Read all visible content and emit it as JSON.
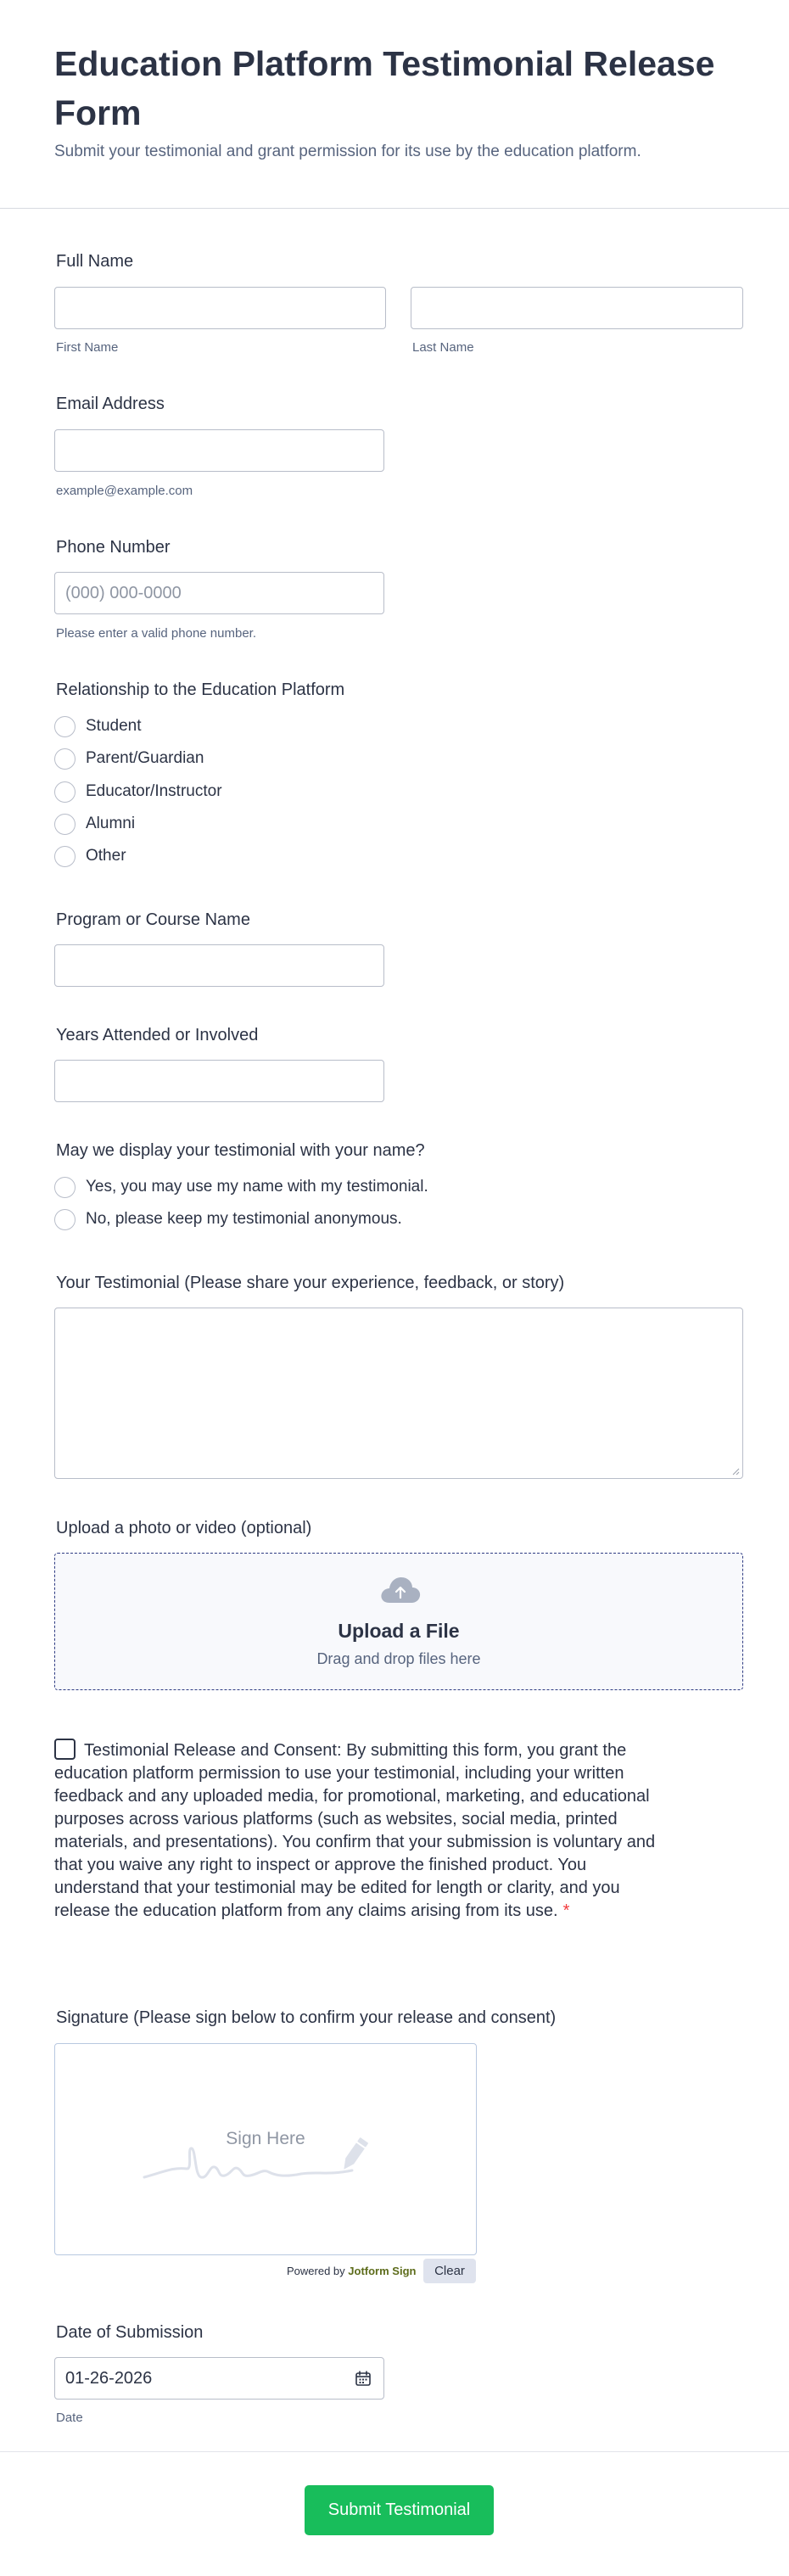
{
  "header": {
    "title": "Education Platform Testimonial Release Form",
    "subtitle": "Submit your testimonial and grant permission for its use by the education platform."
  },
  "full_name": {
    "label": "Full Name",
    "first_value": "",
    "last_value": "",
    "first_sublabel": "First Name",
    "last_sublabel": "Last Name"
  },
  "email": {
    "label": "Email Address",
    "value": "",
    "sublabel": "example@example.com"
  },
  "phone": {
    "label": "Phone Number",
    "placeholder": "(000) 000-0000",
    "sublabel": "Please enter a valid phone number."
  },
  "relationship": {
    "label": "Relationship to the Education Platform",
    "options": [
      "Student",
      "Parent/Guardian",
      "Educator/Instructor",
      "Alumni",
      "Other"
    ]
  },
  "program": {
    "label": "Program or Course Name",
    "value": ""
  },
  "years": {
    "label": "Years Attended or Involved",
    "value": ""
  },
  "display_name": {
    "label": "May we display your testimonial with your name?",
    "options": [
      "Yes, you may use my name with my testimonial.",
      "No, please keep my testimonial anonymous."
    ]
  },
  "testimonial": {
    "label": "Your Testimonial (Please share your experience, feedback, or story)",
    "value": ""
  },
  "upload": {
    "label": "Upload a photo or video (optional)",
    "title": "Upload a File",
    "subtitle": "Drag and drop files here",
    "icon": "cloud-upload-icon"
  },
  "consent": {
    "text": "Testimonial Release and Consent: By submitting this form, you grant the education platform permission to use your testimonial, including your written feedback and any uploaded media, for promotional, marketing, and educational purposes across various platforms (such as websites, social media, printed materials, and presentations). You confirm that your submission is voluntary and that you waive any right to inspect or approve the finished product. You understand that your testimonial may be edited for length or clarity, and you release the education platform from any claims arising from its use.",
    "required_mark": "*",
    "checked": false
  },
  "signature": {
    "label": "Signature (Please sign below to confirm your release and consent)",
    "hint": "Sign Here",
    "powered_prefix": "Powered by",
    "powered_brand": "Jotform Sign",
    "clear_label": "Clear"
  },
  "date": {
    "label": "Date of Submission",
    "value": "01-26-2026",
    "sublabel": "Date",
    "icon": "calendar-icon"
  },
  "submit": {
    "label": "Submit Testimonial"
  },
  "colors": {
    "submit_bg": "#18bd5b",
    "text": "#2c3345",
    "sublabel": "#57647e",
    "required": "#f23a3c",
    "upload_border": "#2e3b82"
  }
}
